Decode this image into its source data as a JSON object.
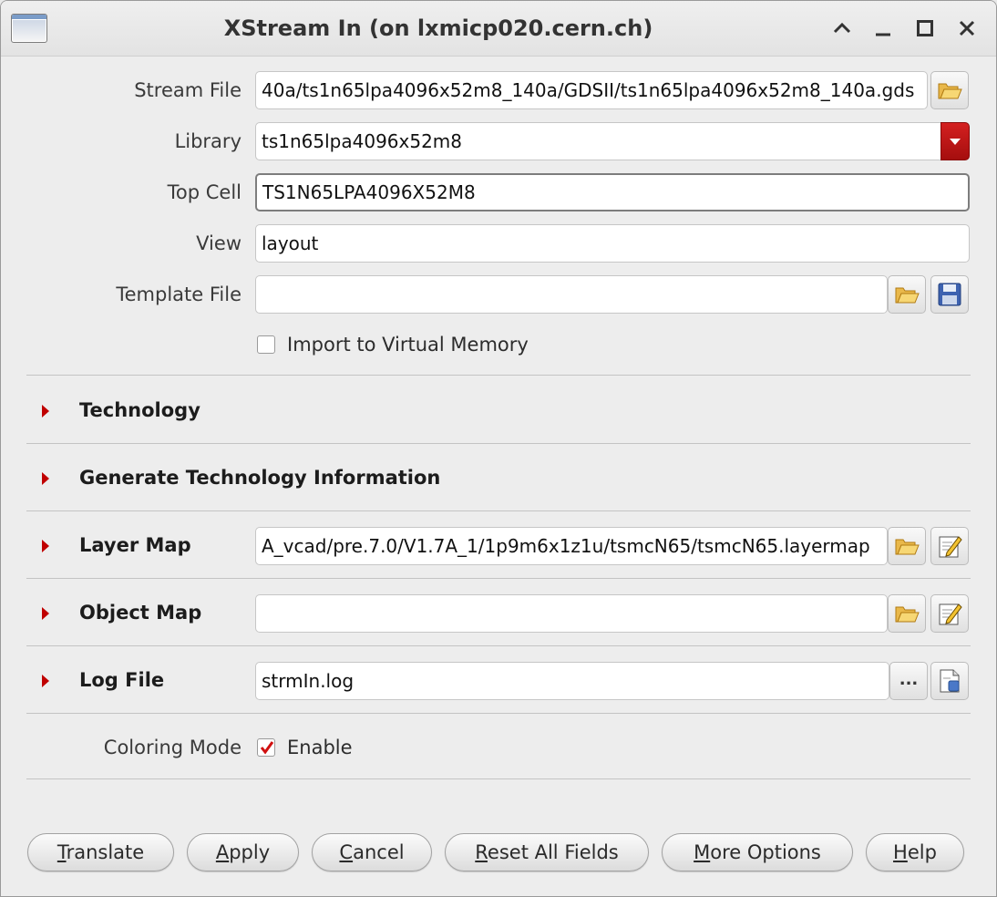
{
  "window": {
    "title": "XStream In (on lxmicp020.cern.ch)"
  },
  "form": {
    "stream_file": {
      "label": "Stream File",
      "value": "40a/ts1n65lpa4096x52m8_140a/GDSII/ts1n65lpa4096x52m8_140a.gds"
    },
    "library": {
      "label": "Library",
      "value": "ts1n65lpa4096x52m8"
    },
    "top_cell": {
      "label": "Top Cell",
      "value": "TS1N65LPA4096X52M8"
    },
    "view": {
      "label": "View",
      "value": "layout"
    },
    "template_file": {
      "label": "Template File",
      "value": ""
    },
    "import_virtual_memory": {
      "label": "Import to Virtual Memory",
      "checked": false
    }
  },
  "sections": {
    "technology": "Technology",
    "generate_tech_info": "Generate Technology Information",
    "layer_map": {
      "label": "Layer Map",
      "value": "A_vcad/pre.7.0/V1.7A_1/1p9m6x1z1u/tsmcN65/tsmcN65.layermap"
    },
    "object_map": {
      "label": "Object Map",
      "value": ""
    },
    "log_file": {
      "label": "Log File",
      "value": "strmIn.log",
      "browse_label": "..."
    }
  },
  "coloring": {
    "label": "Coloring Mode",
    "enable_label": "Enable",
    "checked": true
  },
  "buttons": {
    "translate": {
      "first": "T",
      "rest": "ranslate"
    },
    "apply": {
      "first": "A",
      "rest": "pply"
    },
    "cancel": {
      "first": "C",
      "rest": "ancel"
    },
    "reset": {
      "first": "R",
      "rest": "eset All Fields"
    },
    "more": {
      "first": "M",
      "rest": "ore Options"
    },
    "help": {
      "first": "H",
      "rest": "elp"
    }
  },
  "colors": {
    "accent_red": "#c00000",
    "dropdown_red": "#c41515"
  },
  "icons": [
    "app-icon",
    "maximize-up-icon",
    "minimize-icon",
    "maximize-icon",
    "close-icon",
    "folder-open-icon",
    "save-icon",
    "edit-icon",
    "log-file-icon",
    "checkmark-icon",
    "expand-arrow-icon"
  ]
}
